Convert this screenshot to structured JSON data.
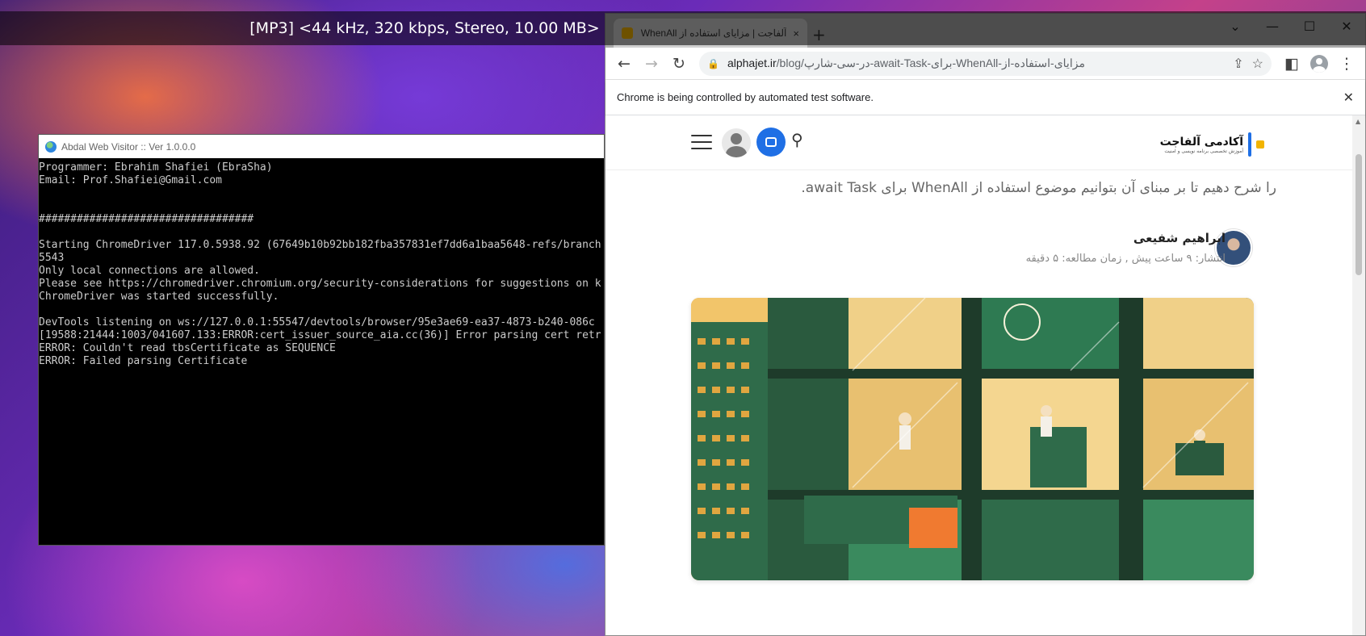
{
  "media_overlay": {
    "text": "[MP3] <44 kHz, 320 kbps, Stereo, 10.00 MB>"
  },
  "console": {
    "title": "Abdal Web Visitor :: Ver 1.0.0.0",
    "lines": [
      "Programmer: Ebrahim Shafiei (EbraSha)",
      "Email: Prof.Shafiei@Gmail.com",
      "",
      "",
      "##################################",
      "",
      "Starting ChromeDriver 117.0.5938.92 (67649b10b92bb182fba357831ef7dd6a1baa5648-refs/branch",
      "5543",
      "Only local connections are allowed.",
      "Please see https://chromedriver.chromium.org/security-considerations for suggestions on k",
      "ChromeDriver was started successfully.",
      "",
      "DevTools listening on ws://127.0.0.1:55547/devtools/browser/95e3ae69-ea37-4873-b240-086c",
      "[19588:21444:1003/041607.133:ERROR:cert_issuer_source_aia.cc(36)] Error parsing cert retr",
      "ERROR: Couldn't read tbsCertificate as SEQUENCE",
      "ERROR: Failed parsing Certificate"
    ]
  },
  "chrome": {
    "tab": {
      "title": "آلفاجت | مزایای استفاده از WhenAll",
      "close_glyph": "×"
    },
    "new_tab_glyph": "+",
    "window_controls": {
      "tab_search": "⌄",
      "minimize": "—",
      "maximize": "☐",
      "close": "✕"
    },
    "toolbar": {
      "back": "←",
      "forward": "→",
      "reload": "↻",
      "url_domain": "alphajet.ir",
      "url_path": "/blog/در-سی-شارپ-await-Task-برای-WhenAll-مزایای-استفاده-از",
      "share": "⇪",
      "bookmark": "☆",
      "side_panel": "◧",
      "menu": "⋮"
    },
    "infobar": {
      "message": "Chrome is being controlled by automated test software.",
      "close": "✕"
    }
  },
  "page": {
    "logo_title": "آکادمی آلفاجت",
    "logo_subtitle": "آموزش تخصصی برنامه نویسی و امنیت",
    "intro_text": "را شرح دهیم تا بر مبنای آن بتوانیم موضوع استفاده از WhenAll برای await Task.",
    "author_name": "ابراهیم شفیعی",
    "meta": "انتشار: ۹ ساعت پیش , زمان مطالعه: ۵ دقیقه",
    "search_glyph": "⚲"
  }
}
